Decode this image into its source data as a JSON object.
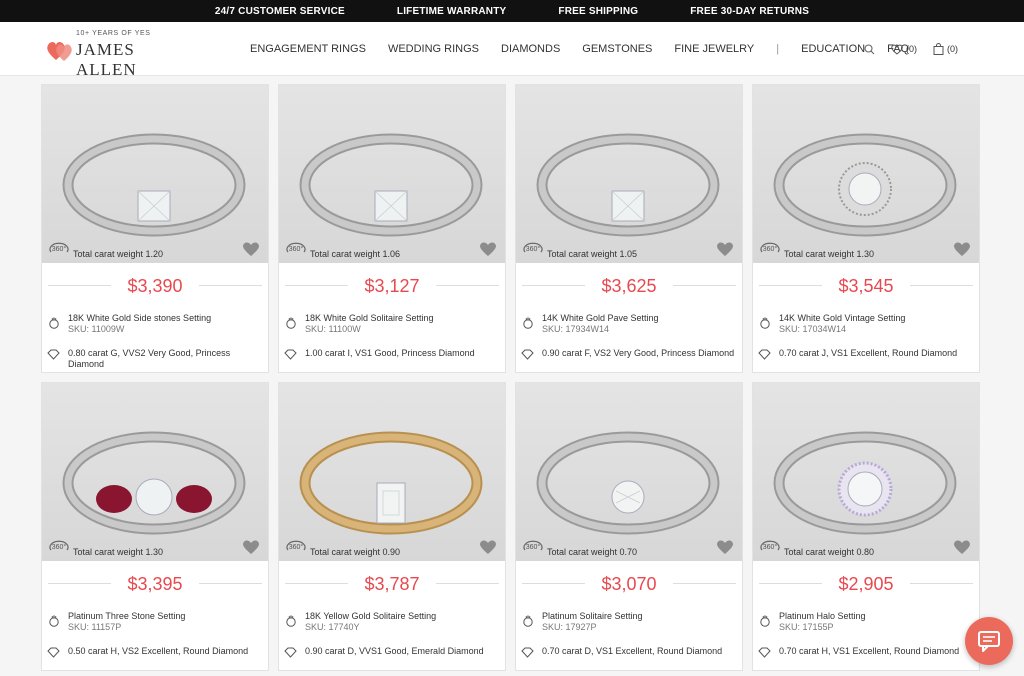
{
  "topbar": {
    "service": "24/7 CUSTOMER SERVICE",
    "warranty": "LIFETIME WARRANTY",
    "shipping": "FREE SHIPPING",
    "returns": "FREE 30-DAY RETURNS"
  },
  "logo": {
    "tagline": "10+ YEARS OF YES",
    "brand": "JAMES ALLEN"
  },
  "nav": {
    "items": [
      "ENGAGEMENT RINGS",
      "WEDDING RINGS",
      "DIAMONDS",
      "GEMSTONES",
      "FINE JEWELRY",
      "EDUCATION",
      "FAQ"
    ],
    "separator": "|"
  },
  "header_icons": {
    "wishlist_count": "(0)",
    "cart_count": "(0)"
  },
  "colors": {
    "accent": "#e8494f",
    "chat": "#ec6a5c"
  },
  "products": [
    {
      "carat": "Total carat weight 1.20",
      "price": "$3,390",
      "setting": "18K White Gold Side stones Setting",
      "sku": "SKU: 11009W",
      "diamond": "0.80 carat G, VVS2 Very Good, Princess Diamond",
      "metal": "white",
      "stone": "princess"
    },
    {
      "carat": "Total carat weight 1.06",
      "price": "$3,127",
      "setting": "18K White Gold Solitaire Setting",
      "sku": "SKU: 11100W",
      "diamond": "1.00 carat I, VS1 Good, Princess Diamond",
      "metal": "white",
      "stone": "princess"
    },
    {
      "carat": "Total carat weight 1.05",
      "price": "$3,625",
      "setting": "14K White Gold Pave Setting",
      "sku": "SKU: 17934W14",
      "diamond": "0.90 carat F, VS2 Very Good, Princess Diamond",
      "metal": "white",
      "stone": "princess"
    },
    {
      "carat": "Total carat weight 1.30",
      "price": "$3,545",
      "setting": "14K White Gold Vintage Setting",
      "sku": "SKU: 17034W14",
      "diamond": "0.70 carat J, VS1 Excellent, Round Diamond",
      "metal": "white",
      "stone": "halo"
    },
    {
      "carat": "Total carat weight 1.30",
      "price": "$3,395",
      "setting": "Platinum Three Stone Setting",
      "sku": "SKU: 11157P",
      "diamond": "0.50 carat H, VS2 Excellent, Round Diamond",
      "metal": "white",
      "stone": "three"
    },
    {
      "carat": "Total carat weight 0.90",
      "price": "$3,787",
      "setting": "18K Yellow Gold Solitaire Setting",
      "sku": "SKU: 17740Y",
      "diamond": "0.90 carat D, VVS1 Good, Emerald Diamond",
      "metal": "yellow",
      "stone": "emerald"
    },
    {
      "carat": "Total carat weight 0.70",
      "price": "$3,070",
      "setting": "Platinum Solitaire Setting",
      "sku": "SKU: 17927P",
      "diamond": "0.70 carat D, VS1 Excellent, Round Diamond",
      "metal": "white",
      "stone": "round"
    },
    {
      "carat": "Total carat weight 0.80",
      "price": "$2,905",
      "setting": "Platinum Halo Setting",
      "sku": "SKU: 17155P",
      "diamond": "0.70 carat H, VS1 Excellent, Round Diamond",
      "metal": "white",
      "stone": "halo-purple"
    }
  ]
}
